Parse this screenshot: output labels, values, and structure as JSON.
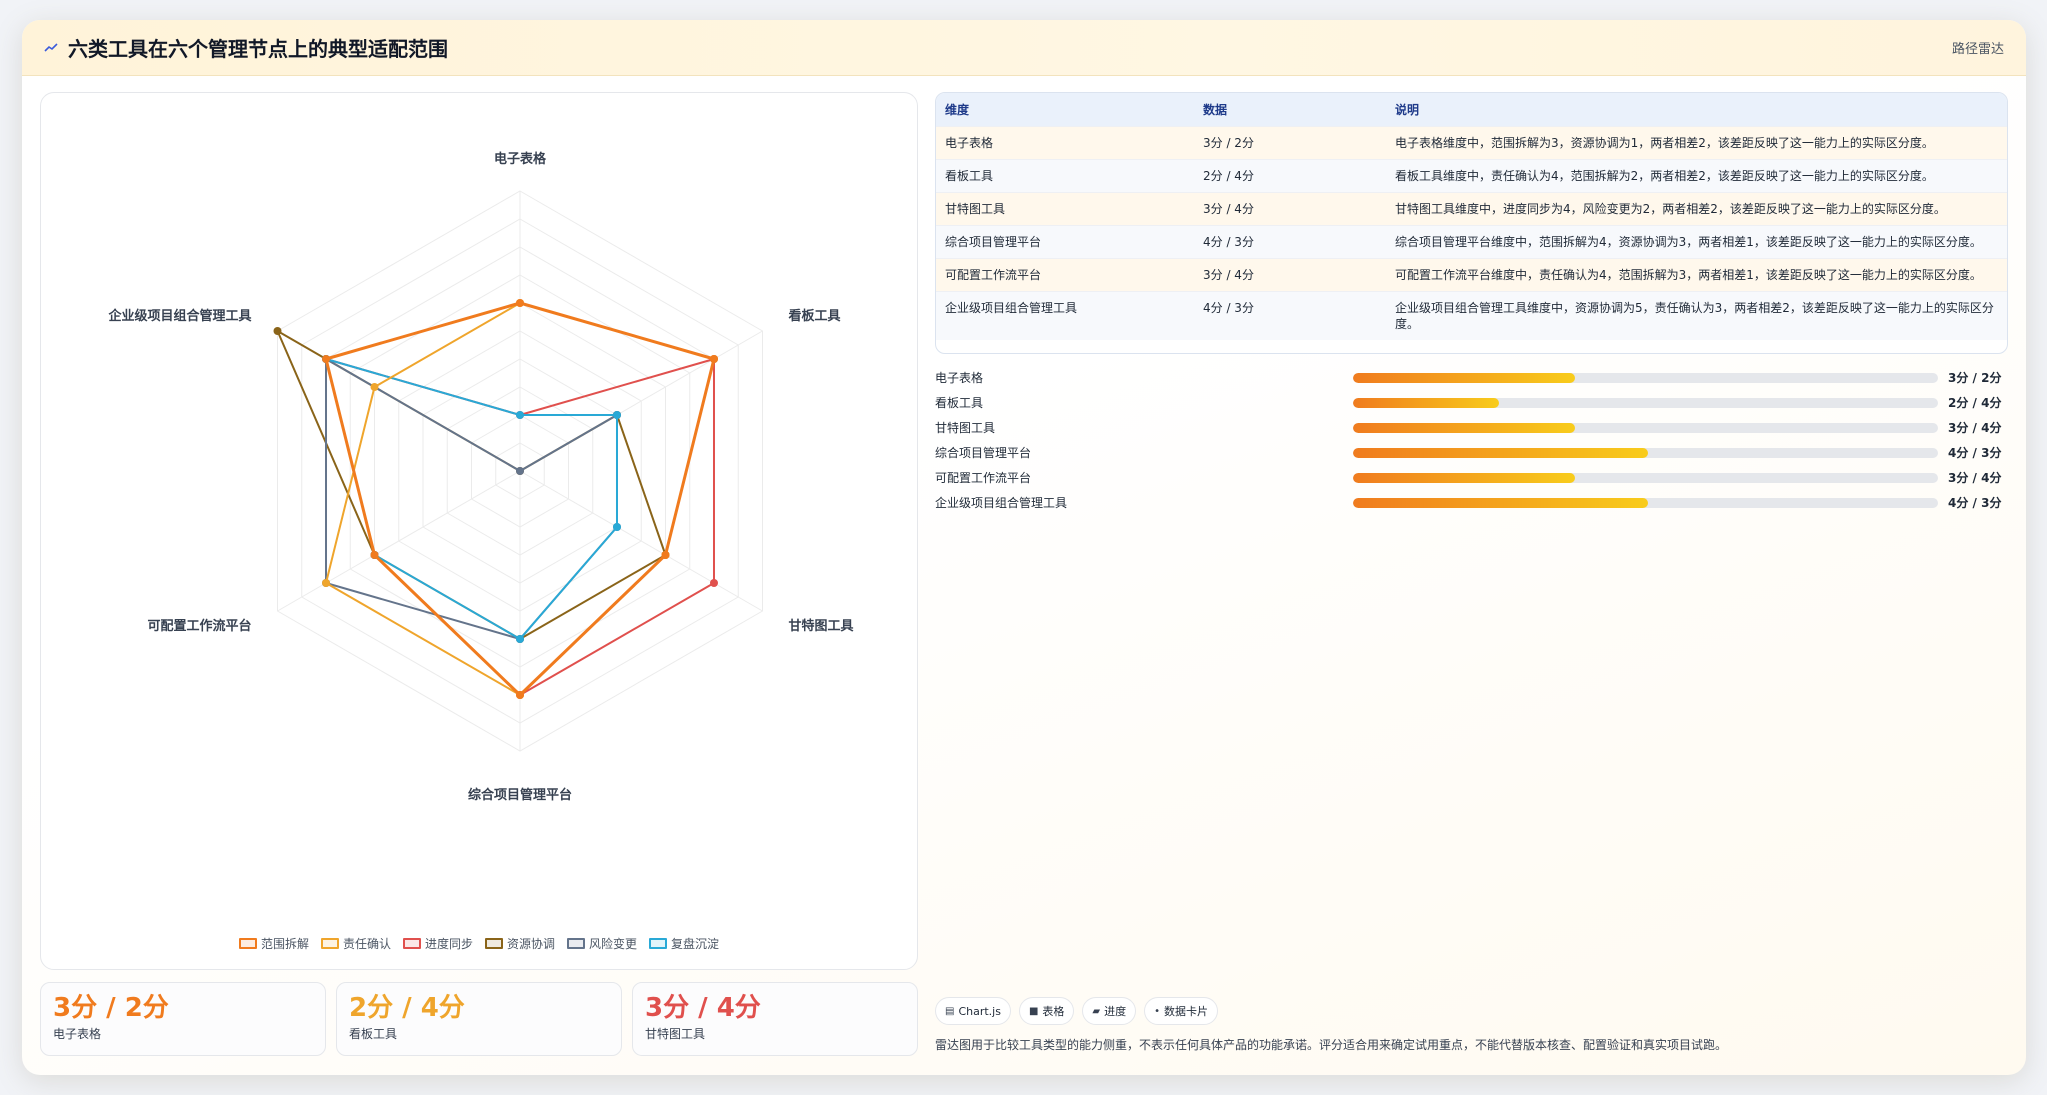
{
  "header": {
    "title": "六类工具在六个管理节点上的典型适配范围",
    "tag": "路径雷达"
  },
  "chart_data": {
    "type": "radar",
    "axes": [
      "电子表格",
      "看板工具",
      "甘特图工具",
      "综合项目管理平台",
      "可配置工作流平台",
      "企业级项目组合管理工具"
    ],
    "rlim": [
      0,
      5
    ],
    "grid": true,
    "legend_position": "bottom",
    "series": [
      {
        "name": "范围拆解",
        "color": "#f07b1e",
        "values": [
          3,
          4,
          3,
          4,
          3,
          4
        ]
      },
      {
        "name": "责任确认",
        "color": "#efa52c",
        "values": [
          3,
          4,
          3,
          4,
          4,
          3
        ]
      },
      {
        "name": "进度同步",
        "color": "#e0504d",
        "values": [
          1,
          4,
          4,
          4,
          3,
          4
        ]
      },
      {
        "name": "资源协调",
        "color": "#8a6419",
        "values": [
          0,
          2,
          3,
          3,
          3,
          5
        ]
      },
      {
        "name": "风险变更",
        "color": "#64748b",
        "values": [
          0,
          2,
          2,
          3,
          4,
          4
        ]
      },
      {
        "name": "复盘沉淀",
        "color": "#29a9d6",
        "values": [
          1,
          2,
          2,
          3,
          3,
          4
        ]
      }
    ]
  },
  "kpis": [
    {
      "value": "3分 / 2分",
      "label": "电子表格",
      "color": "#f07b1e"
    },
    {
      "value": "2分 / 4分",
      "label": "看板工具",
      "color": "#efa52c"
    },
    {
      "value": "3分 / 4分",
      "label": "甘特图工具",
      "color": "#e0504d"
    }
  ],
  "table": {
    "headers": [
      "维度",
      "数据",
      "说明"
    ],
    "rows": [
      [
        "电子表格",
        "3分 / 2分",
        "电子表格维度中，范围拆解为3，资源协调为1，两者相差2，该差距反映了这一能力上的实际区分度。"
      ],
      [
        "看板工具",
        "2分 / 4分",
        "看板工具维度中，责任确认为4，范围拆解为2，两者相差2，该差距反映了这一能力上的实际区分度。"
      ],
      [
        "甘特图工具",
        "3分 / 4分",
        "甘特图工具维度中，进度同步为4，风险变更为2，两者相差2，该差距反映了这一能力上的实际区分度。"
      ],
      [
        "综合项目管理平台",
        "4分 / 3分",
        "综合项目管理平台维度中，范围拆解为4，资源协调为3，两者相差1，该差距反映了这一能力上的实际区分度。"
      ],
      [
        "可配置工作流平台",
        "3分 / 4分",
        "可配置工作流平台维度中，责任确认为4，范围拆解为3，两者相差1，该差距反映了这一能力上的实际区分度。"
      ],
      [
        "企业级项目组合管理工具",
        "4分 / 3分",
        "企业级项目组合管理工具维度中，资源协调为5，责任确认为3，两者相差2，该差距反映了这一能力上的实际区分度。"
      ]
    ]
  },
  "progress": [
    {
      "label": "电子表格",
      "value": "3分 / 2分",
      "fill": 0.38
    },
    {
      "label": "看板工具",
      "value": "2分 / 4分",
      "fill": 0.25
    },
    {
      "label": "甘特图工具",
      "value": "3分 / 4分",
      "fill": 0.38
    },
    {
      "label": "综合项目管理平台",
      "value": "4分 / 3分",
      "fill": 0.505
    },
    {
      "label": "可配置工作流平台",
      "value": "3分 / 4分",
      "fill": 0.38
    },
    {
      "label": "企业级项目组合管理工具",
      "value": "4分 / 3分",
      "fill": 0.505
    }
  ],
  "tags": [
    {
      "icon": "▤",
      "icon_name": "chart-icon",
      "label": "Chart.js"
    },
    {
      "icon": "■",
      "icon_name": "table-icon",
      "label": "表格"
    },
    {
      "icon": "▰",
      "icon_name": "progress-icon",
      "label": "进度"
    },
    {
      "icon": "•",
      "icon_name": "card-icon",
      "label": "数据卡片"
    }
  ],
  "note": "雷达图用于比较工具类型的能力侧重，不表示任何具体产品的功能承诺。评分适合用来确定试用重点，不能代替版本核查、配置验证和真实项目试跑。"
}
